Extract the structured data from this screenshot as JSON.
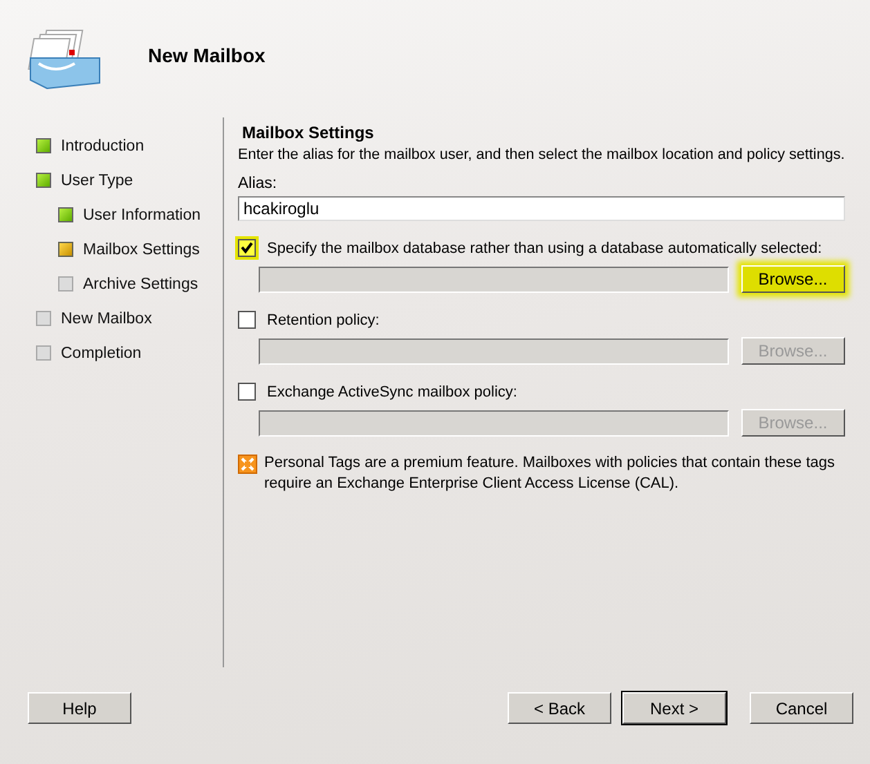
{
  "window": {
    "title": "New Mailbox"
  },
  "steps": [
    {
      "label": "Introduction",
      "kind": "done"
    },
    {
      "label": "User Type",
      "kind": "done",
      "children": [
        {
          "label": "User Information",
          "kind": "done"
        },
        {
          "label": "Mailbox Settings",
          "kind": "current"
        },
        {
          "label": "Archive Settings",
          "kind": "pending"
        }
      ]
    },
    {
      "label": "New Mailbox",
      "kind": "pending"
    },
    {
      "label": "Completion",
      "kind": "pending"
    }
  ],
  "section": {
    "heading": "Mailbox Settings",
    "description": "Enter the alias for the mailbox user, and then select the mailbox location and policy settings."
  },
  "alias": {
    "label": "Alias:",
    "value": "hcakiroglu"
  },
  "options": [
    {
      "label": "Specify the mailbox database rather than using a database automatically selected:",
      "checked": true,
      "highlighted": true,
      "browse": "Browse...",
      "browse_disabled": false
    },
    {
      "label": "Retention policy:",
      "checked": false,
      "highlighted": false,
      "browse": "Browse...",
      "browse_disabled": true
    },
    {
      "label": "Exchange ActiveSync mailbox policy:",
      "checked": false,
      "highlighted": false,
      "browse": "Browse...",
      "browse_disabled": true
    }
  ],
  "note": "Personal Tags are a premium feature. Mailboxes with policies that contain these tags require an Exchange Enterprise Client Access License (CAL).",
  "buttons": [
    {
      "label": "Help",
      "kind": "help",
      "default": false
    },
    {
      "label": "< Back",
      "kind": "nav",
      "default": false
    },
    {
      "label": "Next >",
      "kind": "nav",
      "default": true
    },
    {
      "label": "Cancel",
      "kind": "cancel",
      "default": false
    }
  ]
}
